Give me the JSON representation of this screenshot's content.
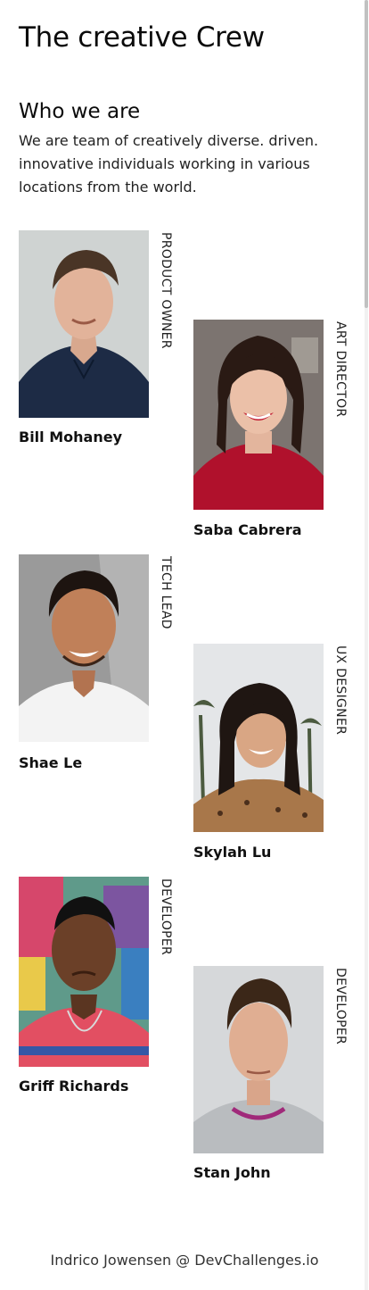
{
  "header": {
    "title": "The creative Crew"
  },
  "about": {
    "heading": "Who we are",
    "text": "We are team of creatively diverse. driven. innovative individuals working in various locations from the world."
  },
  "members": [
    {
      "name": "Bill Mohaney",
      "role": "PRODUCT OWNER"
    },
    {
      "name": "Saba Cabrera",
      "role": "ART DIRECTOR"
    },
    {
      "name": "Shae Le",
      "role": "TECH LEAD"
    },
    {
      "name": "Skylah Lu",
      "role": "UX DESIGNER"
    },
    {
      "name": "Griff Richards",
      "role": "DEVELOPER"
    },
    {
      "name": "Stan John",
      "role": "DEVELOPER"
    }
  ],
  "footer": {
    "credit": "Indrico Jowensen @ DevChallenges.io"
  }
}
